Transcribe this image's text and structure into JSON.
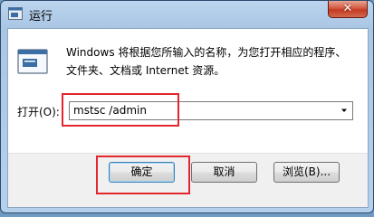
{
  "window": {
    "title": "运行",
    "close_symbol": "✕",
    "icons": {
      "title": "run-icon",
      "close": "close-icon",
      "body": "run-icon"
    }
  },
  "content": {
    "description_line1": "Windows 将根据您所输入的名称，为您打开相应的程序、",
    "description_line2": "文件夹、文档或 Internet 资源。"
  },
  "open_field": {
    "label": "打开(O):",
    "value": "mstsc /admin",
    "dropdown_icon": "chevron-down-icon"
  },
  "buttons": {
    "ok": "确定",
    "cancel": "取消",
    "browse": "浏览(B)..."
  },
  "colors": {
    "highlight": "#e3262c",
    "title_bar": "#a9c6e4",
    "close_button": "#c23a22"
  }
}
